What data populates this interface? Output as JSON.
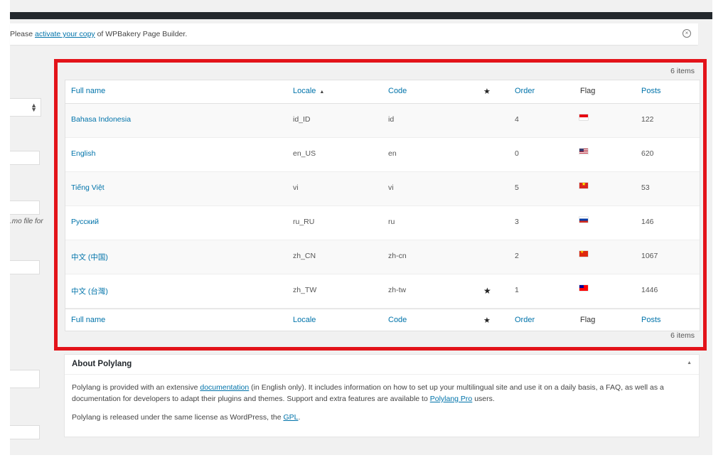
{
  "notice": {
    "prefix": "Please ",
    "link": "activate your copy",
    "suffix": " of WPBakery Page Builder."
  },
  "sidebar": {
    "mo_text": ".mo file for"
  },
  "table": {
    "count_label": "6 items",
    "columns": {
      "full_name": "Full name",
      "locale": "Locale",
      "code": "Code",
      "default_star": "★",
      "order": "Order",
      "flag": "Flag",
      "posts": "Posts"
    },
    "sort_indicator": "▲",
    "rows": [
      {
        "name": "Bahasa Indonesia",
        "locale": "id_ID",
        "code": "id",
        "default": "",
        "order": "4",
        "flag": "flag-id",
        "posts": "122"
      },
      {
        "name": "English",
        "locale": "en_US",
        "code": "en",
        "default": "",
        "order": "0",
        "flag": "flag-us",
        "posts": "620"
      },
      {
        "name": "Tiếng Việt",
        "locale": "vi",
        "code": "vi",
        "default": "",
        "order": "5",
        "flag": "flag-vn",
        "posts": "53"
      },
      {
        "name": "Русский",
        "locale": "ru_RU",
        "code": "ru",
        "default": "",
        "order": "3",
        "flag": "flag-ru",
        "posts": "146"
      },
      {
        "name": "中文 (中国)",
        "locale": "zh_CN",
        "code": "zh-cn",
        "default": "",
        "order": "2",
        "flag": "flag-cn",
        "posts": "1067"
      },
      {
        "name": "中文 (台灣)",
        "locale": "zh_TW",
        "code": "zh-tw",
        "default": "★",
        "order": "1",
        "flag": "flag-tw",
        "posts": "1446"
      }
    ]
  },
  "about": {
    "title": "About Polylang",
    "p1_a": "Polylang is provided with an extensive ",
    "p1_link1": "documentation",
    "p1_b": " (in English only). It includes information on how to set up your multilingual site and use it on a daily basis, a FAQ, as well as a documentation for developers to adapt their plugins and themes. Support and extra features are available to ",
    "p1_link2": "Polylang Pro",
    "p1_c": " users.",
    "p2_a": "Polylang is released under the same license as WordPress, the ",
    "p2_link": "GPL",
    "p2_b": "."
  },
  "colors": {
    "accent": "#0073aa",
    "highlight_border": "#e3131a",
    "admin_bar": "#23282d"
  }
}
